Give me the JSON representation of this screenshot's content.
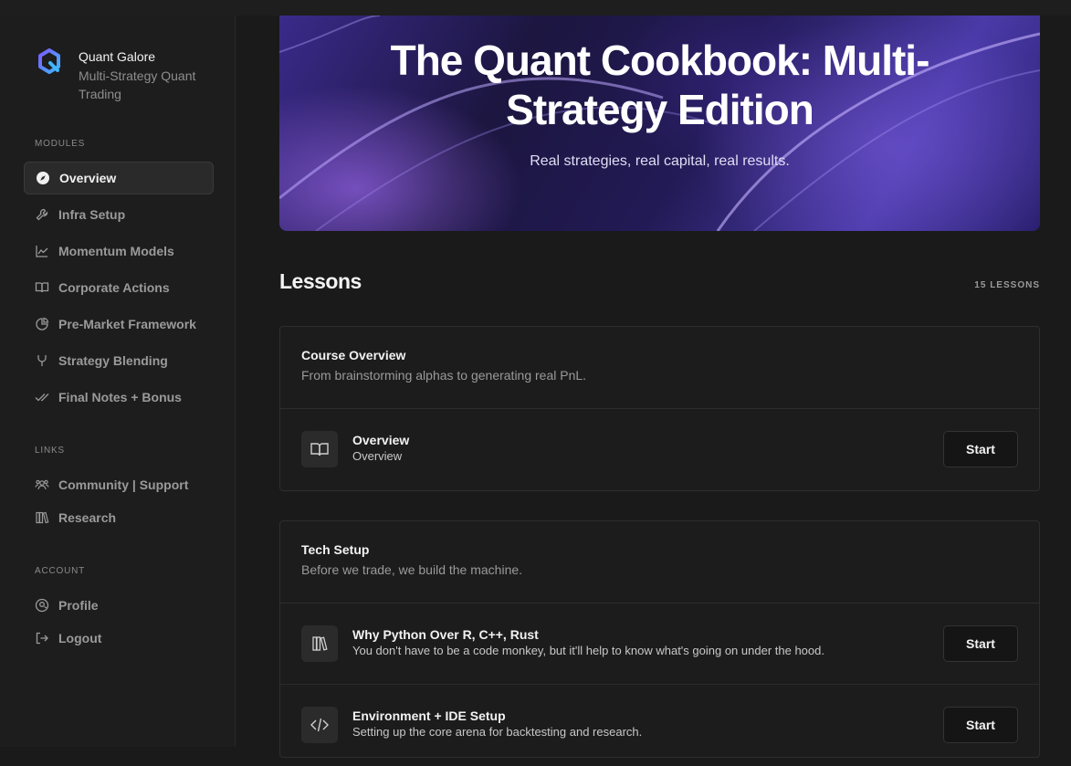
{
  "brand": {
    "name": "Quant Galore",
    "subtitle": "Multi-Strategy Quant Trading"
  },
  "sidebar": {
    "modules_label": "MODULES",
    "modules": [
      {
        "label": "Overview",
        "icon": "compass-icon",
        "active": true
      },
      {
        "label": "Infra Setup",
        "icon": "wrench-icon"
      },
      {
        "label": "Momentum Models",
        "icon": "line-chart-icon"
      },
      {
        "label": "Corporate Actions",
        "icon": "book-open-icon"
      },
      {
        "label": "Pre-Market Framework",
        "icon": "pie-chart-icon"
      },
      {
        "label": "Strategy Blending",
        "icon": "merge-icon"
      },
      {
        "label": "Final Notes + Bonus",
        "icon": "double-check-icon"
      }
    ],
    "links_label": "LINKS",
    "links": [
      {
        "label": "Community | Support",
        "icon": "users-icon"
      },
      {
        "label": "Research",
        "icon": "library-icon"
      }
    ],
    "account_label": "ACCOUNT",
    "account": [
      {
        "label": "Profile",
        "icon": "user-circle-icon"
      },
      {
        "label": "Logout",
        "icon": "logout-icon"
      }
    ]
  },
  "hero": {
    "title_line1": "The Quant Cookbook: Multi-",
    "title_line2": "Strategy Edition",
    "subtitle": "Real strategies, real capital, real results."
  },
  "lessons": {
    "title": "Lessons",
    "count": "15 LESSONS",
    "sections": [
      {
        "title": "Course Overview",
        "description": "From brainstorming alphas to generating real PnL.",
        "items": [
          {
            "name": "Overview",
            "subtitle": "Overview",
            "icon": "book-open-icon",
            "button": "Start"
          }
        ]
      },
      {
        "title": "Tech Setup",
        "description": "Before we trade, we build the machine.",
        "items": [
          {
            "name": "Why Python Over R, C++, Rust",
            "subtitle": "You don't have to be a code monkey, but it'll help to know what's going on under the hood.",
            "icon": "library-icon",
            "button": "Start"
          },
          {
            "name": "Environment + IDE Setup",
            "subtitle": "Setting up the core arena for backtesting and research.",
            "icon": "code-icon",
            "button": "Start"
          }
        ]
      }
    ]
  }
}
